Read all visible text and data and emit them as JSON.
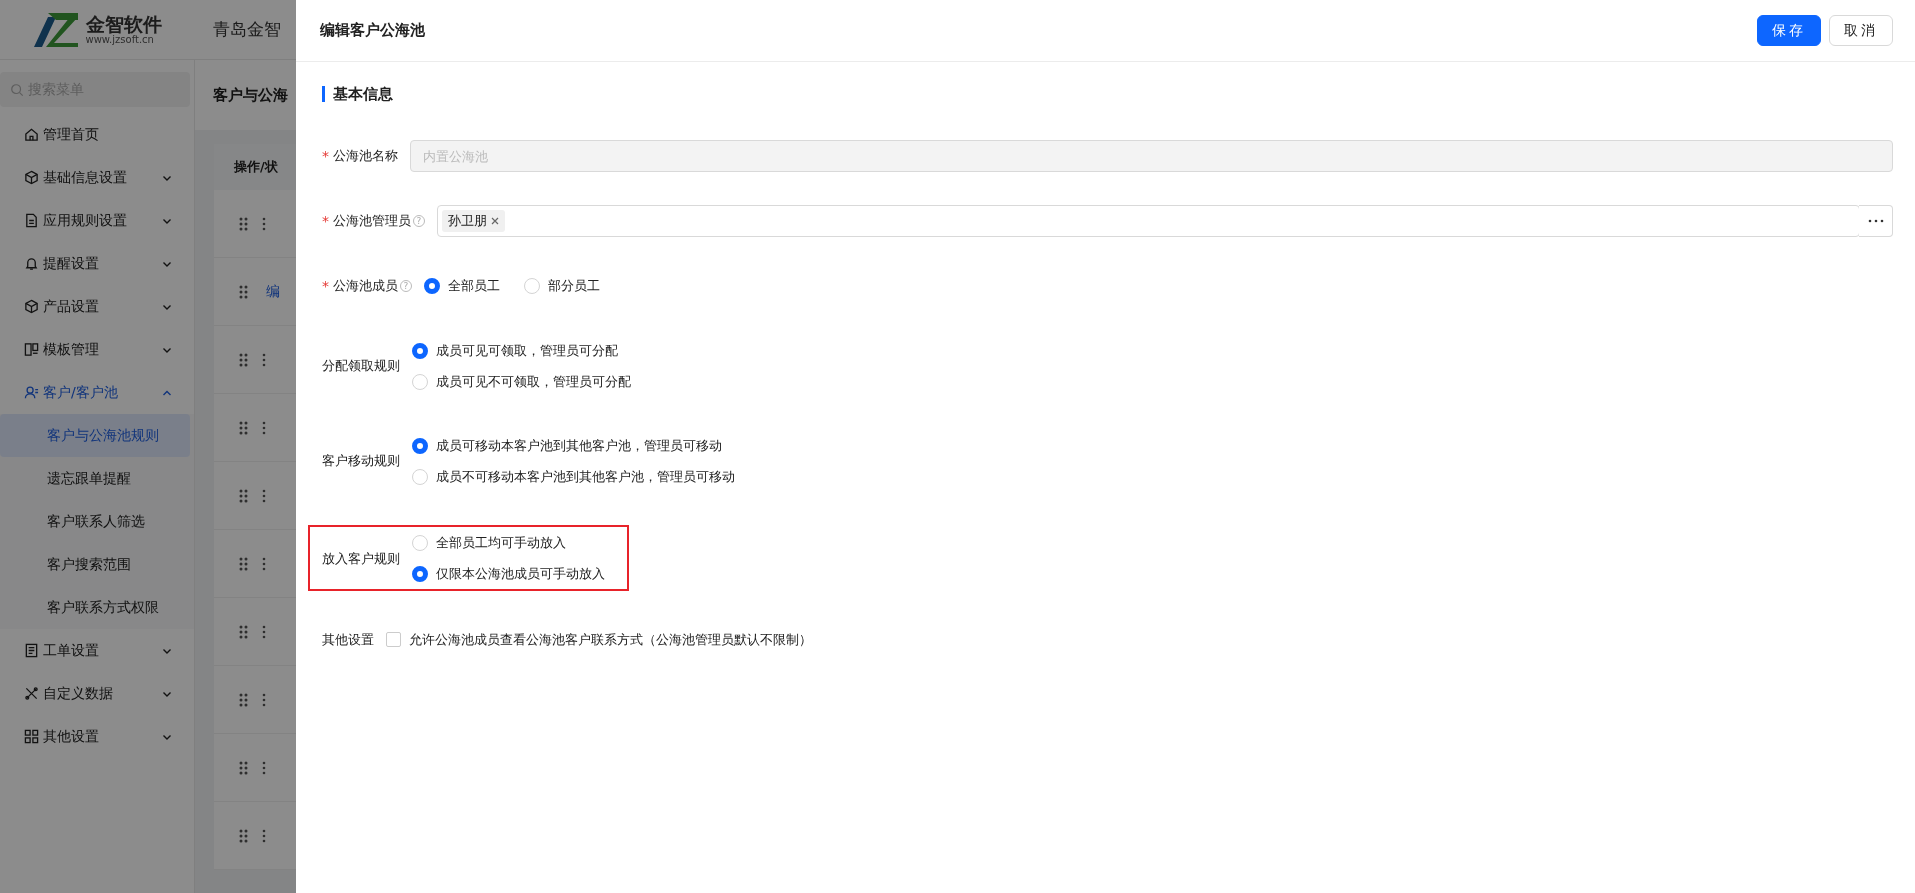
{
  "app": {
    "logo_name": "金智软件",
    "logo_url": "www.jzsoft.cn",
    "company": "青岛金智"
  },
  "sidebar": {
    "search_placeholder": "搜索菜单",
    "items": [
      {
        "label": "管理首页",
        "selected": false
      },
      {
        "label": "基础信息设置",
        "selected": false,
        "expanded": false
      },
      {
        "label": "应用规则设置",
        "selected": false,
        "expanded": false
      },
      {
        "label": "提醒设置",
        "selected": false,
        "expanded": false
      },
      {
        "label": "产品设置",
        "selected": false,
        "expanded": false
      },
      {
        "label": "模板管理",
        "selected": false,
        "expanded": false
      },
      {
        "label": "客户/客户池",
        "selected": true,
        "expanded": true,
        "children": [
          {
            "label": "客户与公海池规则",
            "selected": true
          },
          {
            "label": "遗忘跟单提醒",
            "selected": false
          },
          {
            "label": "客户联系人筛选",
            "selected": false
          },
          {
            "label": "客户搜索范围",
            "selected": false
          },
          {
            "label": "客户联系方式权限",
            "selected": false
          }
        ]
      },
      {
        "label": "工单设置",
        "selected": false,
        "expanded": false
      },
      {
        "label": "自定义数据",
        "selected": false,
        "expanded": false
      },
      {
        "label": "其他设置",
        "selected": false,
        "expanded": false
      }
    ]
  },
  "page_title": "客户与公海",
  "table": {
    "columns": [
      "操作/状"
    ],
    "rows": [
      {
        "kind": "actions"
      },
      {
        "kind": "link",
        "text": "编"
      },
      {
        "kind": "actions"
      },
      {
        "kind": "actions"
      },
      {
        "kind": "actions"
      },
      {
        "kind": "actions"
      },
      {
        "kind": "actions"
      },
      {
        "kind": "actions"
      },
      {
        "kind": "actions"
      },
      {
        "kind": "actions"
      }
    ]
  },
  "drawer": {
    "title": "编辑客户公海池",
    "buttons": [
      {
        "label": "保存",
        "kind": "primary"
      },
      {
        "label": "取消",
        "kind": "secondary"
      }
    ],
    "section": "基本信息",
    "fields": [
      {
        "kind": "text",
        "label": "公海池名称",
        "required_mark": "*",
        "placeholder": "内置公海池",
        "disabled": true
      },
      {
        "kind": "tags",
        "label": "公海池管理员",
        "required_mark": "*",
        "help": "?",
        "tags": [
          "孙卫朋"
        ]
      },
      {
        "kind": "radio-inline",
        "label": "公海池成员",
        "required_mark": "*",
        "help": "?",
        "options": [
          {
            "label": "全部员工",
            "selected": true
          },
          {
            "label": "部分员工",
            "selected": false
          }
        ]
      },
      {
        "kind": "radio",
        "label": "分配领取规则",
        "options": [
          {
            "label": "成员可见可领取，管理员可分配",
            "selected": true
          },
          {
            "label": "成员可见不可领取，管理员可分配",
            "selected": false
          }
        ]
      },
      {
        "kind": "radio",
        "label": "客户移动规则",
        "options": [
          {
            "label": "成员可移动本客户池到其他客户池，管理员可移动",
            "selected": true
          },
          {
            "label": "成员不可移动本客户池到其他客户池，管理员可移动",
            "selected": false
          }
        ]
      },
      {
        "kind": "radio",
        "label": "放入客户规则",
        "highlighted": true,
        "options": [
          {
            "label": "全部员工均可手动放入",
            "selected": false
          },
          {
            "label": "仅限本公海池成员可手动放入",
            "selected": true
          }
        ]
      },
      {
        "kind": "checkbox",
        "label": "其他设置",
        "options": [
          {
            "label": "允许公海池成员查看公海池客户联系方式（公海池管理员默认不限制）",
            "checked": false
          }
        ]
      }
    ]
  }
}
